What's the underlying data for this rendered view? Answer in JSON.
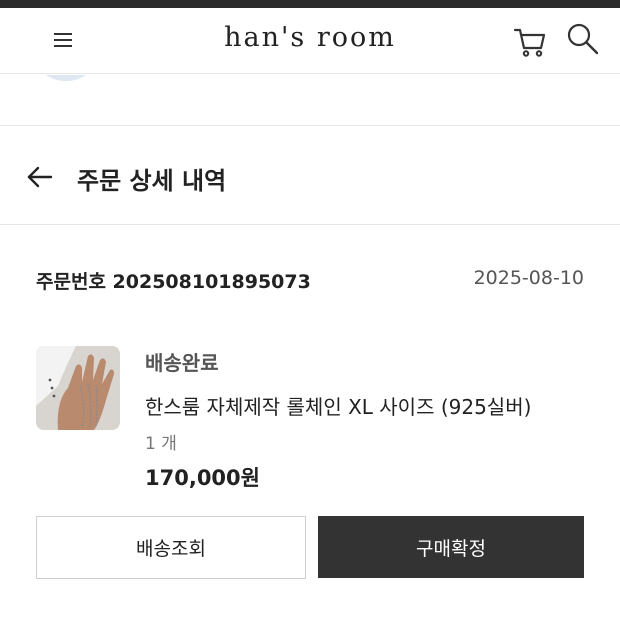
{
  "header": {
    "logo": "han's room",
    "menu_icon": "hamburger-menu-icon",
    "cart_icon": "cart-icon",
    "search_icon": "search-icon"
  },
  "page": {
    "back_icon": "arrow-left-icon",
    "title": "주문 상세 내역"
  },
  "order": {
    "number_label": "주문번호 202508101895073",
    "date": "2025-08-10",
    "item": {
      "status": "배송완료",
      "name": "한스룸 자체제작 롤체인 XL 사이즈 (925실버)",
      "quantity": "1 개",
      "price": "170,000원"
    },
    "actions": {
      "track_label": "배송조회",
      "confirm_label": "구매확정"
    }
  },
  "colors": {
    "accent_dark": "#333333",
    "divider": "#e6e6e6"
  }
}
